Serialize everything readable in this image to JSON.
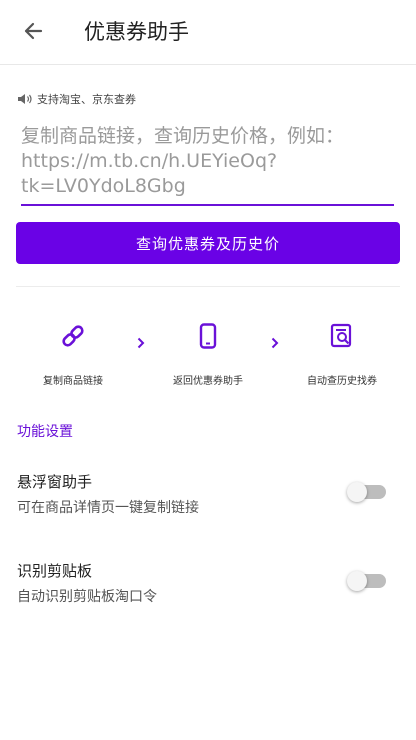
{
  "appbar": {
    "title": "优惠券助手"
  },
  "hint": {
    "text": "支持淘宝、京东查券",
    "icon": "speaker-icon"
  },
  "input": {
    "placeholder": "复制商品链接，查询历史价格，例如：https://m.tb.cn/h.UEYieOq?tk=LV0YdoL8Gbg",
    "value": ""
  },
  "primary_button": {
    "label": "查询优惠券及历史价"
  },
  "steps": [
    {
      "label": "复制商品链接",
      "icon": "link-icon"
    },
    {
      "label": "返回优惠券助手",
      "icon": "phone-icon"
    },
    {
      "label": "自动查历史找券",
      "icon": "search-document-icon"
    }
  ],
  "settings": {
    "section_title": "功能设置",
    "items": [
      {
        "title": "悬浮窗助手",
        "desc": "可在商品详情页一键复制链接",
        "enabled": false
      },
      {
        "title": "识别剪贴板",
        "desc": "自动识别剪贴板淘口令",
        "enabled": false
      }
    ]
  },
  "colors": {
    "accent": "#6a02e6",
    "text_accent": "#6a11d8"
  }
}
